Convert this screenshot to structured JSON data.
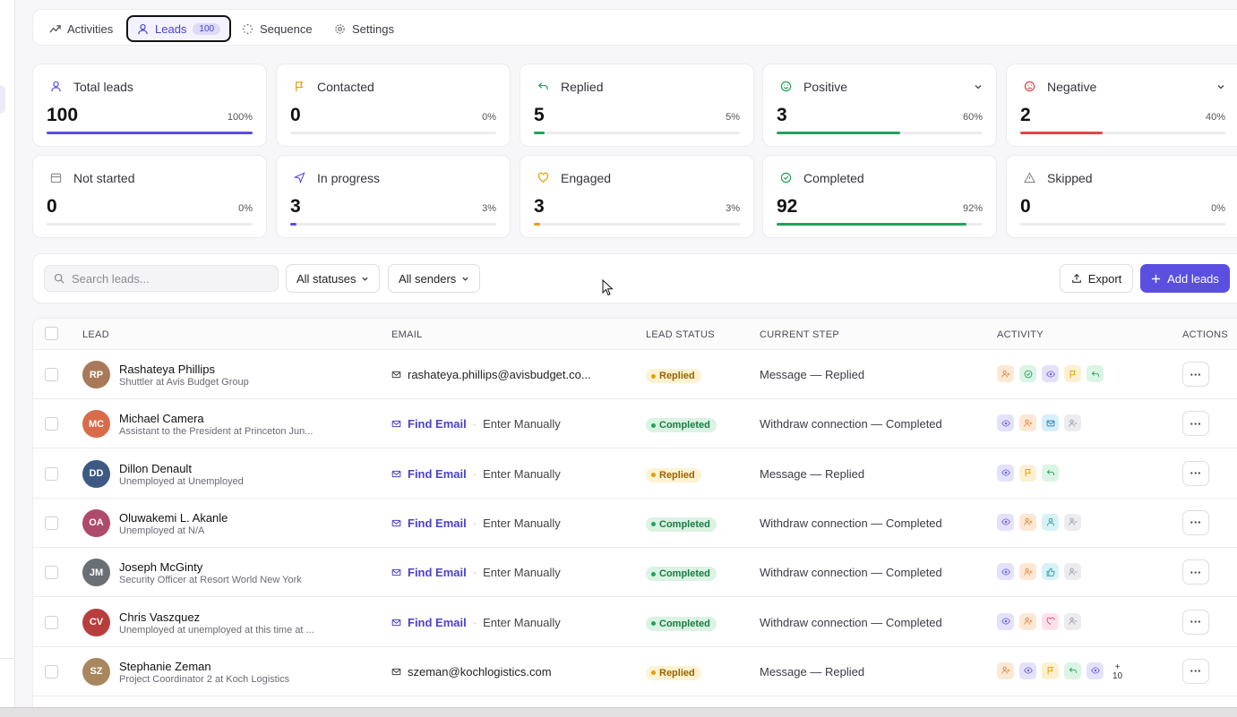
{
  "tabs": [
    {
      "label": "Activities",
      "icon": "trend-icon"
    },
    {
      "label": "Leads",
      "icon": "user-icon",
      "count": "100"
    },
    {
      "label": "Sequence",
      "icon": "loader-icon"
    },
    {
      "label": "Settings",
      "icon": "gear-icon"
    }
  ],
  "stats": [
    {
      "label": "Total leads",
      "value": "100",
      "pct": "100%",
      "fill": 1.0,
      "color": "#5a4fe0",
      "icon": "user-icon"
    },
    {
      "label": "Contacted",
      "value": "0",
      "pct": "0%",
      "fill": 0,
      "color": "#e0a000",
      "icon": "flag-icon"
    },
    {
      "label": "Replied",
      "value": "5",
      "pct": "5%",
      "fill": 0.05,
      "color": "#22a35a",
      "icon": "reply-icon"
    },
    {
      "label": "Positive",
      "value": "3",
      "pct": "60%",
      "fill": 0.6,
      "color": "#22a35a",
      "icon": "smile-icon",
      "dropdown": true
    },
    {
      "label": "Negative",
      "value": "2",
      "pct": "40%",
      "fill": 0.4,
      "color": "#e04848",
      "icon": "frown-icon",
      "dropdown": true
    },
    {
      "label": "Not started",
      "value": "0",
      "pct": "0%",
      "fill": 0,
      "color": "#888888",
      "icon": "calendar-icon"
    },
    {
      "label": "In progress",
      "value": "3",
      "pct": "3%",
      "fill": 0.03,
      "color": "#5a4fe0",
      "icon": "send-icon"
    },
    {
      "label": "Engaged",
      "value": "3",
      "pct": "3%",
      "fill": 0.03,
      "color": "#e0a000",
      "icon": "heart-icon"
    },
    {
      "label": "Completed",
      "value": "92",
      "pct": "92%",
      "fill": 0.92,
      "color": "#22a35a",
      "icon": "check-circle-icon"
    },
    {
      "label": "Skipped",
      "value": "0",
      "pct": "0%",
      "fill": 0,
      "color": "#888888",
      "icon": "warning-icon"
    }
  ],
  "toolbar": {
    "search_placeholder": "Search leads...",
    "status_filter": "All statuses",
    "sender_filter": "All senders",
    "export_label": "Export",
    "add_label": "Add leads"
  },
  "columns": {
    "lead": "LEAD",
    "email": "EMAIL",
    "status": "LEAD STATUS",
    "step": "CURRENT STEP",
    "activity": "ACTIVITY",
    "actions": "ACTIONS"
  },
  "rows": [
    {
      "initials": "RP",
      "avatar": "#a87a5a",
      "name": "Rashateya Phillips",
      "title": "Shuttler at Avis Budget Group",
      "email": "rashateya.phillips@avisbudget.co...",
      "status": "Replied",
      "step": "Message — Replied",
      "activity": [
        "add-user",
        "check",
        "eye",
        "flag",
        "reply"
      ]
    },
    {
      "initials": "MC",
      "avatar": "#d86c4a",
      "name": "Michael Camera",
      "title": "Assistant to the President at Princeton Jun...",
      "find": "Find Email",
      "manual": "Enter Manually",
      "status": "Completed",
      "step": "Withdraw connection — Completed",
      "activity": [
        "eye",
        "add-user",
        "mail",
        "remove-user"
      ]
    },
    {
      "initials": "DD",
      "avatar": "#3e5a84",
      "name": "Dillon Denault",
      "title": "Unemployed at Unemployed",
      "find": "Find Email",
      "manual": "Enter Manually",
      "status": "Replied",
      "step": "Message — Replied",
      "activity": [
        "eye",
        "flag",
        "reply"
      ]
    },
    {
      "initials": "OA",
      "avatar": "#b04a6a",
      "name": "Oluwakemi L. Akanle",
      "title": "Unemployed at N/A",
      "find": "Find Email",
      "manual": "Enter Manually",
      "status": "Completed",
      "step": "Withdraw connection — Completed",
      "activity": [
        "eye",
        "add-user",
        "user",
        "remove-user"
      ]
    },
    {
      "initials": "JM",
      "avatar": "#6a6e75",
      "name": "Joseph McGinty",
      "title": "Security Officer at Resort World New York",
      "find": "Find Email",
      "manual": "Enter Manually",
      "status": "Completed",
      "step": "Withdraw connection — Completed",
      "activity": [
        "eye",
        "add-user",
        "thumbs-up",
        "remove-user"
      ]
    },
    {
      "initials": "CV",
      "avatar": "#b83e3e",
      "name": "Chris Vaszquez",
      "title": "Unemployed at unemployed at this time at ...",
      "find": "Find Email",
      "manual": "Enter Manually",
      "status": "Completed",
      "step": "Withdraw connection — Completed",
      "activity": [
        "eye",
        "add-user",
        "heart",
        "remove-user"
      ]
    },
    {
      "initials": "SZ",
      "avatar": "#a8875e",
      "name": "Stephanie Zeman",
      "title": "Project Coordinator 2 at Koch Logistics",
      "email": "szeman@kochlogistics.com",
      "status": "Replied",
      "step": "Message — Replied",
      "activity": [
        "add-user",
        "eye",
        "flag",
        "reply",
        "eye"
      ],
      "more_count": "+\n10"
    }
  ]
}
